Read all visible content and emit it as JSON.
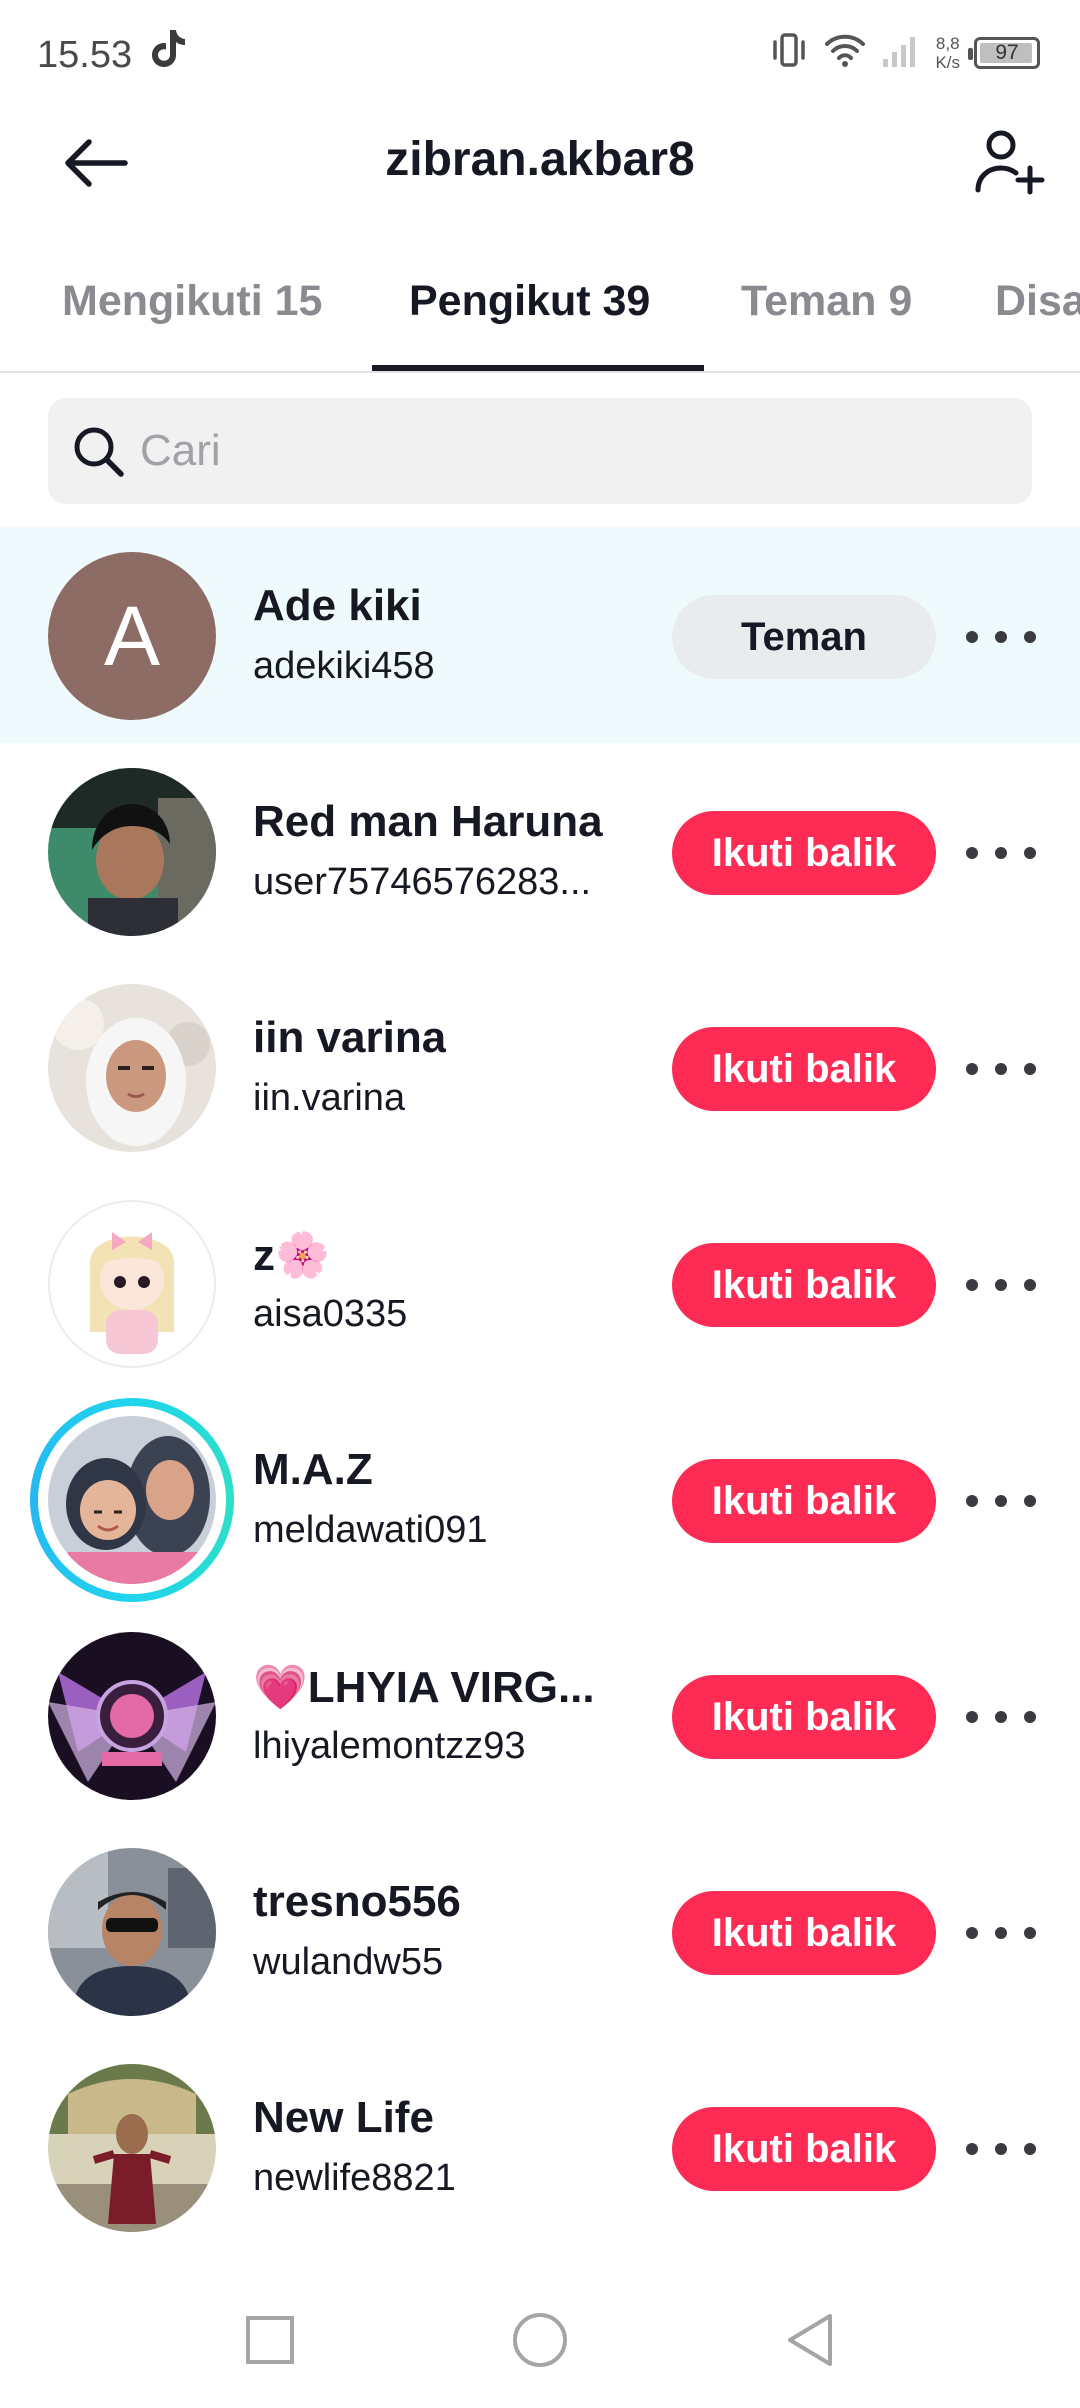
{
  "status_bar": {
    "time": "15.53",
    "speed_value": "8,8",
    "speed_unit": "K/s",
    "battery": "97",
    "battery_level": 0.97
  },
  "header": {
    "title": "zibran.akbar8"
  },
  "tabs": [
    {
      "label": "Mengikuti 15",
      "active": false
    },
    {
      "label": "Pengikut 39",
      "active": true
    },
    {
      "label": "Teman 9",
      "active": false
    },
    {
      "label": "Disa",
      "active": false
    }
  ],
  "search": {
    "placeholder": "Cari"
  },
  "followers": [
    {
      "name": "Ade kiki",
      "handle": "adekiki458",
      "button": "Teman",
      "button_type": "friend",
      "avatar": "letter",
      "avatar_letter": "A"
    },
    {
      "name": "Red man Haruna",
      "handle": "user75746576283...",
      "button": "Ikuti balik",
      "button_type": "follow",
      "avatar": "photo"
    },
    {
      "name": "iin varina",
      "handle": "iin.varina",
      "button": "Ikuti balik",
      "button_type": "follow",
      "avatar": "photo"
    },
    {
      "name": "z🌸",
      "handle": "aisa0335",
      "button": "Ikuti balik",
      "button_type": "follow",
      "avatar": "photo"
    },
    {
      "name": "M.A.Z",
      "handle": "meldawati091",
      "button": "Ikuti balik",
      "button_type": "follow",
      "avatar": "photo-story"
    },
    {
      "name": "💗LHYIA VIRG...",
      "handle": "lhiyalemontzz93",
      "button": "Ikuti balik",
      "button_type": "follow",
      "avatar": "photo"
    },
    {
      "name": "tresno556",
      "handle": "wulandw55",
      "button": "Ikuti balik",
      "button_type": "follow",
      "avatar": "photo"
    },
    {
      "name": "New Life",
      "handle": "newlife8821",
      "button": "Ikuti balik",
      "button_type": "follow",
      "avatar": "photo"
    }
  ],
  "icons": {
    "back": "arrow-left-icon",
    "add_user": "person-add-icon",
    "search": "search-icon",
    "more": "more-horizontal-icon",
    "nav_recent": "square-icon",
    "nav_home": "circle-icon",
    "nav_back": "triangle-back-icon"
  },
  "colors": {
    "follow_button": "#fe2c55",
    "friend_button": "#e8eced",
    "highlight_row": "#effafd",
    "story_ring": "#20d5ec"
  }
}
